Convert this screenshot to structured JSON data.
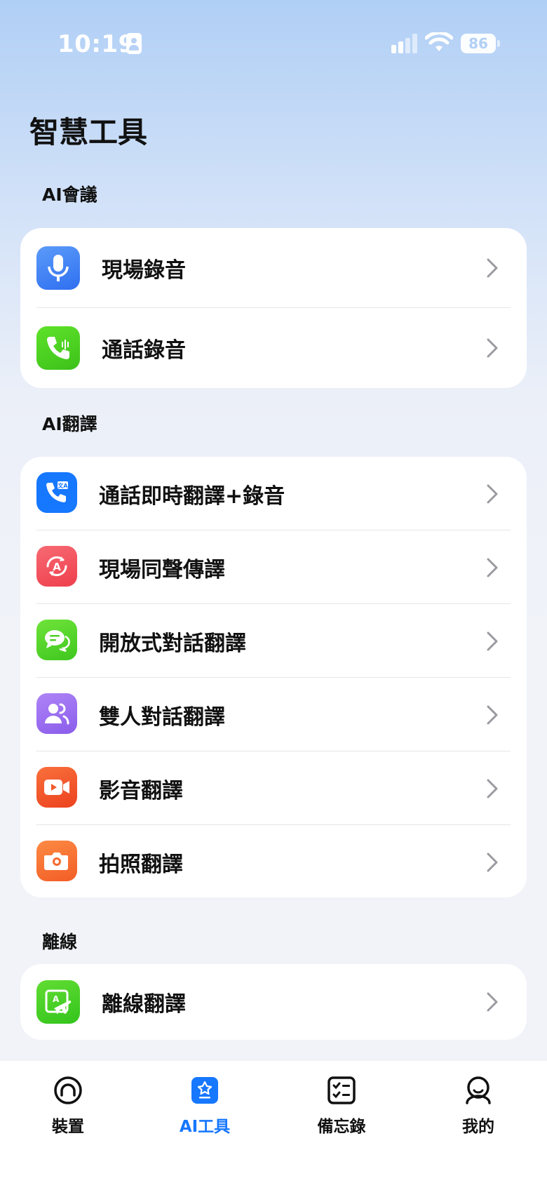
{
  "status_bar": {
    "time": "10:19",
    "battery": "86",
    "icons": [
      "person-card-icon",
      "signal-icon",
      "wifi-icon",
      "battery-icon"
    ]
  },
  "page": {
    "title": "智慧工具"
  },
  "sections": [
    {
      "label": "AI會議",
      "items": [
        {
          "label": "現場錄音",
          "icon": "microphone-icon",
          "color": "#3d82f5"
        },
        {
          "label": "通話錄音",
          "icon": "phone-wave-icon",
          "color": "#4cd21c"
        }
      ]
    },
    {
      "label": "AI翻譯",
      "items": [
        {
          "label": "通話即時翻譯+錄音",
          "icon": "phone-translate-icon",
          "color": "#1677ff"
        },
        {
          "label": "現場同聲傳譯",
          "icon": "sync-translate-icon",
          "color": "#f2525e"
        },
        {
          "label": "開放式對話翻譯",
          "icon": "chat-bubbles-icon",
          "color": "#50cf27"
        },
        {
          "label": "雙人對話翻譯",
          "icon": "two-people-icon",
          "color": "#9a6cf0"
        },
        {
          "label": "影音翻譯",
          "icon": "video-icon",
          "color": "#f4582a"
        },
        {
          "label": "拍照翻譯",
          "icon": "camera-icon",
          "color": "#f86c32"
        }
      ]
    },
    {
      "label": "離線",
      "items": [
        {
          "label": "離線翻譯",
          "icon": "offline-translate-icon",
          "color": "#3fcf28"
        }
      ]
    }
  ],
  "tabbar": {
    "active": 1,
    "tabs": [
      {
        "label": "裝置",
        "icon": "headphones-icon"
      },
      {
        "label": "AI工具",
        "icon": "ai-tools-icon"
      },
      {
        "label": "備忘錄",
        "icon": "checklist-icon"
      },
      {
        "label": "我的",
        "icon": "profile-icon"
      }
    ]
  },
  "colors": {
    "accent": "#1677ff",
    "header_gradient_top": "#b0cff5",
    "background": "#f2f3f7"
  }
}
